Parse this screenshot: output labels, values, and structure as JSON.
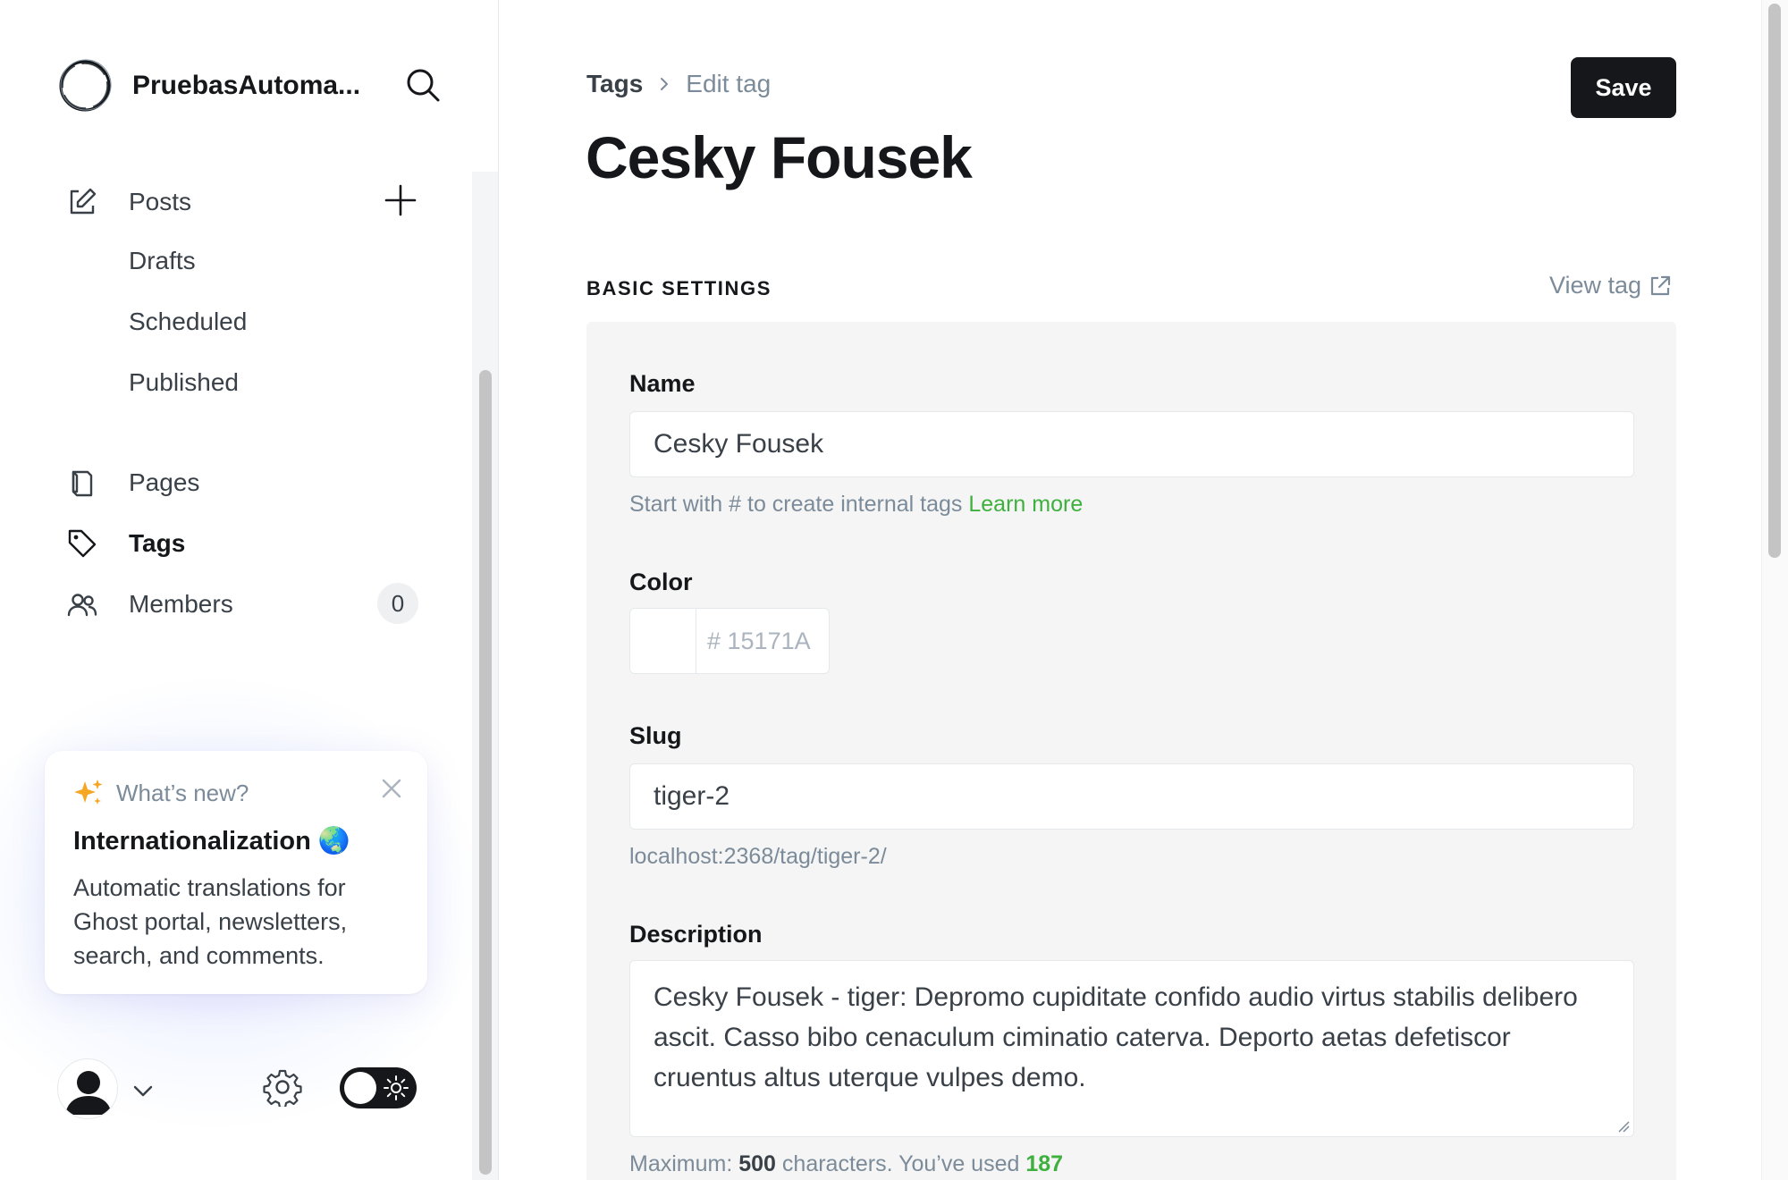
{
  "brand": {
    "name": "PruebasAutoma..."
  },
  "nav": {
    "posts": "Posts",
    "drafts": "Drafts",
    "scheduled": "Scheduled",
    "published": "Published",
    "pages": "Pages",
    "tags": "Tags",
    "members": "Members",
    "members_count": "0"
  },
  "news": {
    "heading": "What’s new?",
    "title": "Internationalization 🌏",
    "body": "Automatic translations for Ghost portal, newsletters, search, and comments."
  },
  "header": {
    "breadcrumb_root": "Tags",
    "breadcrumb_current": "Edit tag",
    "title": "Cesky Fousek",
    "save_label": "Save"
  },
  "section": {
    "label": "BASIC SETTINGS",
    "view_tag": "View tag"
  },
  "form": {
    "name_label": "Name",
    "name_value": "Cesky Fousek",
    "name_hint": "Start with # to create internal tags",
    "learn_more": "Learn more",
    "color_label": "Color",
    "color_value": "# 15171A",
    "slug_label": "Slug",
    "slug_value": "tiger-2",
    "slug_url": "localhost:2368/tag/tiger-2/",
    "description_label": "Description",
    "description_value": "Cesky Fousek - tiger: Depromo cupiditate confido audio virtus stabilis delibero ascit. Casso bibo cenaculum ciminatio caterva. Deporto aetas defetiscor cruentus altus uterque vulpes demo.",
    "counter_prefix": "Maximum:",
    "counter_max": "500",
    "counter_mid": "characters. You’ve used",
    "counter_used": "187"
  },
  "colors": {
    "accent_green": "#3eb03e",
    "primary_dark": "#15171a"
  }
}
